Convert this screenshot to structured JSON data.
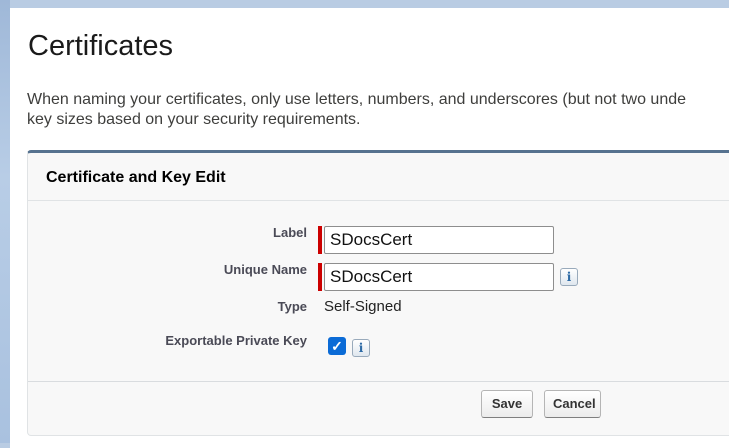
{
  "page": {
    "title": "Certificates",
    "intro_line1": "When naming your certificates, only use letters, numbers, and underscores (but not two unde",
    "intro_line2": "key sizes based on your security requirements."
  },
  "section": {
    "title": "Certificate and Key Edit"
  },
  "form": {
    "label": {
      "label": "Label",
      "value": "SDocsCert",
      "required": true
    },
    "unique_name": {
      "label": "Unique Name",
      "value": "SDocsCert",
      "required": true,
      "info_icon": "i"
    },
    "type": {
      "label": "Type",
      "value": "Self-Signed"
    },
    "exportable": {
      "label": "Exportable Private Key",
      "checked": true,
      "check_glyph": "✓",
      "info_icon": "i"
    }
  },
  "buttons": {
    "save": "Save",
    "cancel": "Cancel"
  },
  "colors": {
    "required_marker": "#cc0000",
    "section_border": "#56728f",
    "checkbox_fill": "#0b6bd6"
  }
}
